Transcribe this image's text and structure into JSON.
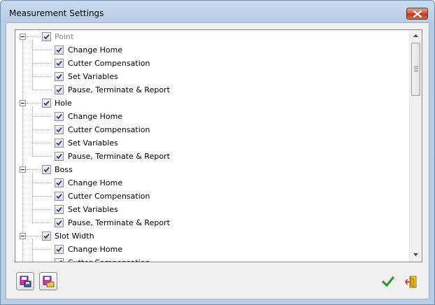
{
  "window": {
    "title": "Measurement Settings"
  },
  "tree": {
    "groups": [
      {
        "label": "Point",
        "disabled": true,
        "children": [
          "Change Home",
          "Cutter Compensation",
          "Set Variables",
          "Pause, Terminate & Report"
        ]
      },
      {
        "label": "Hole",
        "disabled": false,
        "children": [
          "Change Home",
          "Cutter Compensation",
          "Set Variables",
          "Pause, Terminate & Report"
        ]
      },
      {
        "label": "Boss",
        "disabled": false,
        "children": [
          "Change Home",
          "Cutter Compensation",
          "Set Variables",
          "Pause, Terminate & Report"
        ]
      },
      {
        "label": "Slot Width",
        "disabled": false,
        "children": [
          "Change Home",
          "Cutter Compensation"
        ]
      }
    ]
  },
  "colors": {
    "accept": "#2e9a2e",
    "close": "#c8523b"
  },
  "icons": {
    "save": "save-settings-icon",
    "load": "load-settings-icon",
    "ok": "checkmark-icon",
    "exit": "exit-door-icon"
  }
}
